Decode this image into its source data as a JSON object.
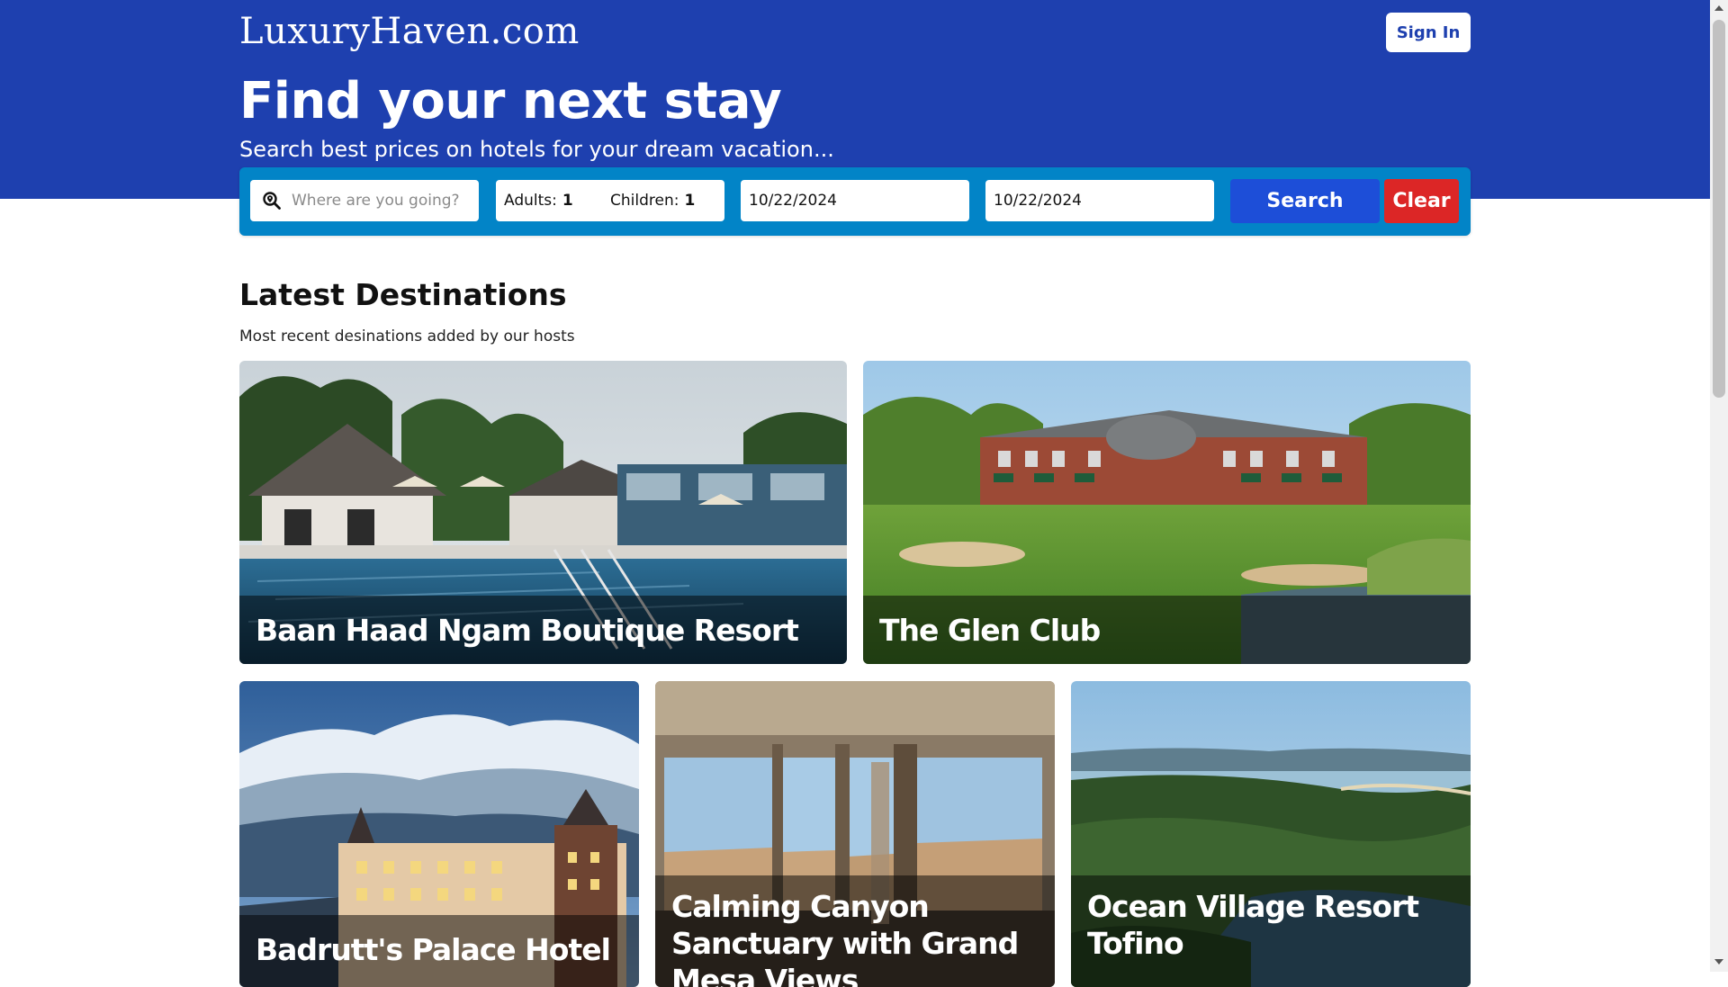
{
  "header": {
    "logo": "LuxuryHaven.com",
    "sign_in_label": "Sign In",
    "headline": "Find your next stay",
    "subheadline": "Search best prices on hotels for your dream vacation..."
  },
  "search": {
    "destination_placeholder": "Where are you going?",
    "adults_label": "Adults:",
    "adults_value": "1",
    "children_label": "Children:",
    "children_value": "1",
    "check_in": "10/22/2024",
    "check_out": "10/22/2024",
    "search_label": "Search",
    "clear_label": "Clear"
  },
  "destinations": {
    "title": "Latest Destinations",
    "subtitle": "Most recent desinations added by our hosts",
    "items": [
      {
        "name": "Baan Haad Ngam Boutique Resort"
      },
      {
        "name": "The Glen Club"
      },
      {
        "name": "Badrutt's Palace Hotel"
      },
      {
        "name": "Calming Canyon Sanctuary with Grand Mesa Views"
      },
      {
        "name": "Ocean Village Resort Tofino"
      }
    ]
  },
  "colors": {
    "hero_bg": "#1e40af",
    "search_bar_bg": "#0284c7",
    "search_button": "#1d4ed8",
    "clear_button": "#dc2626"
  },
  "icons": {
    "destination": "search-location-icon"
  }
}
